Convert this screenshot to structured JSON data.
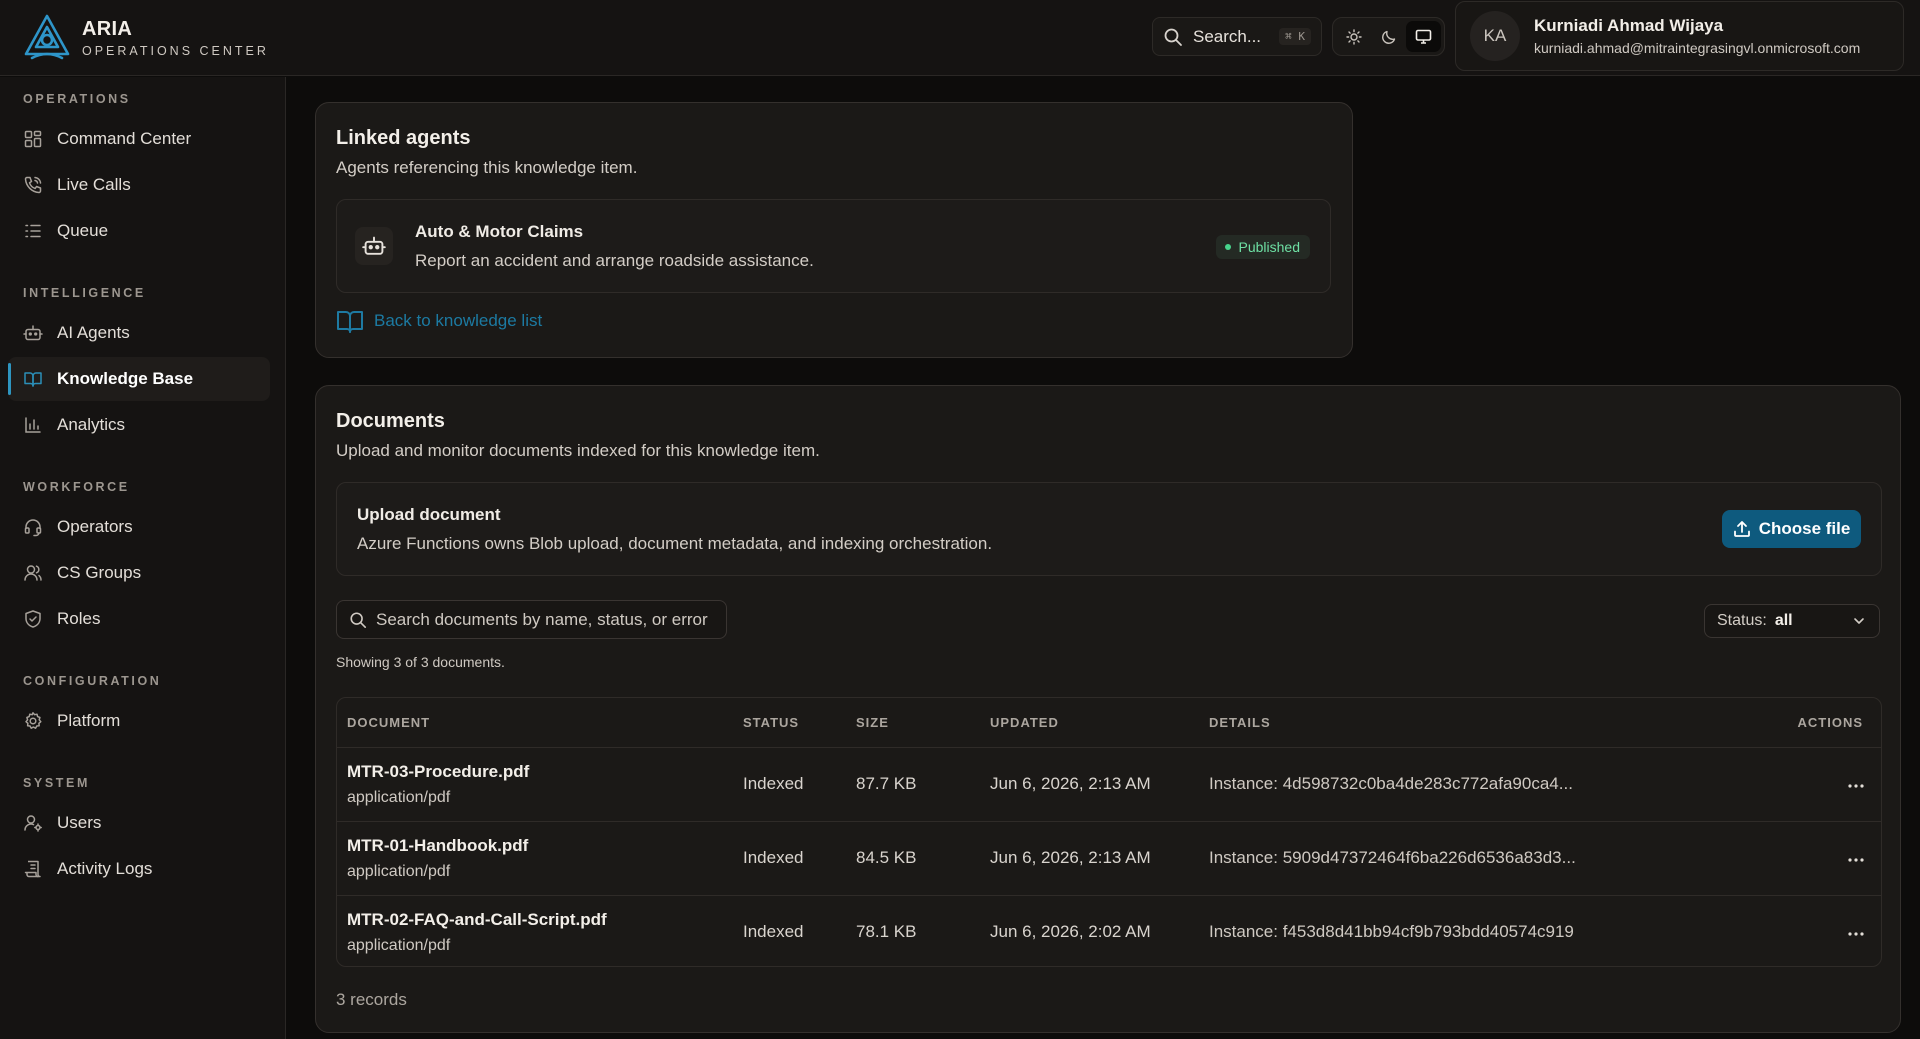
{
  "brand": {
    "name": "ARIA",
    "subtitle": "OPERATIONS CENTER"
  },
  "header": {
    "search_label": "Search...",
    "search_shortcut": "⌘ K",
    "theme_modes": [
      "sun-icon",
      "moon-icon",
      "monitor-icon"
    ],
    "theme_active": "monitor",
    "user": {
      "initials": "KA",
      "name": "Kurniadi Ahmad Wijaya",
      "email": "kurniadi.ahmad@mitraintegrasingvl.onmicrosoft.com"
    }
  },
  "sidebar": {
    "sections": [
      {
        "title": "OPERATIONS",
        "items": [
          {
            "label": "Command Center",
            "icon": "grid-icon"
          },
          {
            "label": "Live Calls",
            "icon": "phone-icon"
          },
          {
            "label": "Queue",
            "icon": "list-icon"
          }
        ]
      },
      {
        "title": "INTELLIGENCE",
        "items": [
          {
            "label": "AI Agents",
            "icon": "bot-icon"
          },
          {
            "label": "Knowledge Base",
            "icon": "book-icon",
            "active": true
          },
          {
            "label": "Analytics",
            "icon": "bar-chart-icon"
          }
        ]
      },
      {
        "title": "WORKFORCE",
        "items": [
          {
            "label": "Operators",
            "icon": "headset-icon"
          },
          {
            "label": "CS Groups",
            "icon": "users-icon"
          },
          {
            "label": "Roles",
            "icon": "shield-icon"
          }
        ]
      },
      {
        "title": "CONFIGURATION",
        "items": [
          {
            "label": "Platform",
            "icon": "gear-icon"
          }
        ]
      },
      {
        "title": "SYSTEM",
        "items": [
          {
            "label": "Users",
            "icon": "user-cog-icon"
          },
          {
            "label": "Activity Logs",
            "icon": "log-icon"
          }
        ]
      }
    ]
  },
  "linked_agents": {
    "title": "Linked agents",
    "subtitle": "Agents referencing this knowledge item.",
    "agents": [
      {
        "name": "Auto & Motor Claims",
        "description": "Report an accident and arrange roadside assistance.",
        "status": "Published"
      }
    ],
    "back_link": "Back to knowledge list"
  },
  "documents": {
    "title": "Documents",
    "subtitle": "Upload and monitor documents indexed for this knowledge item.",
    "upload": {
      "title": "Upload document",
      "description": "Azure Functions owns Blob upload, document metadata, and indexing orchestration.",
      "button": "Choose file"
    },
    "search_placeholder": "Search documents by name, status, or error",
    "status_filter": {
      "label": "Status:",
      "value": "all"
    },
    "showing": "Showing 3 of 3 documents.",
    "columns": [
      "DOCUMENT",
      "STATUS",
      "SIZE",
      "UPDATED",
      "DETAILS",
      "ACTIONS"
    ],
    "rows": [
      {
        "name": "MTR-03-Procedure.pdf",
        "type": "application/pdf",
        "status": "Indexed",
        "size": "87.7 KB",
        "updated": "Jun 6, 2026, 2:13 AM",
        "details": "Instance: 4d598732c0ba4de283c772afa90ca4..."
      },
      {
        "name": "MTR-01-Handbook.pdf",
        "type": "application/pdf",
        "status": "Indexed",
        "size": "84.5 KB",
        "updated": "Jun 6, 2026, 2:13 AM",
        "details": "Instance: 5909d47372464f6ba226d6536a83d3..."
      },
      {
        "name": "MTR-02-FAQ-and-Call-Script.pdf",
        "type": "application/pdf",
        "status": "Indexed",
        "size": "78.1 KB",
        "updated": "Jun 6, 2026, 2:02 AM",
        "details": "Instance: f453d8d41bb94cf9b793bdd40574c919"
      }
    ],
    "records": "3 records"
  },
  "colors": {
    "accent": "#0e5a7e",
    "link": "#1c7aa2",
    "published": "#6ee0a4"
  }
}
